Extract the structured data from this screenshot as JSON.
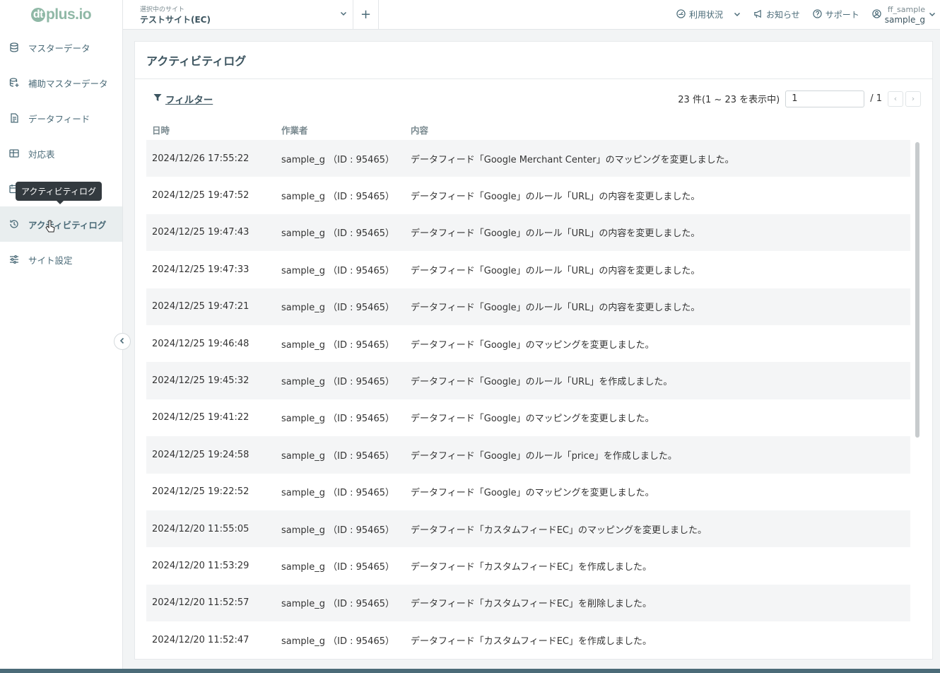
{
  "logo": {
    "mark": "dt",
    "text": "plus.io"
  },
  "sidebar": {
    "items": [
      {
        "label": "マスターデータ",
        "icon": "database-icon"
      },
      {
        "label": "補助マスターデータ",
        "icon": "database-plus-icon"
      },
      {
        "label": "データフィード",
        "icon": "document-icon"
      },
      {
        "label": "対応表",
        "icon": "table-icon"
      },
      {
        "label": "",
        "icon": "calendar-icon"
      },
      {
        "label": "アクティビティログ",
        "icon": "history-icon"
      },
      {
        "label": "サイト設定",
        "icon": "sliders-icon"
      }
    ],
    "tooltip": "アクティビティログ"
  },
  "header": {
    "site_caption": "選択中のサイト",
    "site_name": "テストサイト(EC)",
    "add": "+",
    "usage": "利用状況",
    "news": "お知らせ",
    "support": "サポート",
    "account": "ff_sample",
    "user": "sample_g"
  },
  "main": {
    "title": "アクティビティログ",
    "filter": "フィルター",
    "count": "23 件(1 ~ 23 を表示中)",
    "page_value": "1",
    "page_total": "/ 1",
    "columns": {
      "date": "日時",
      "user": "作業者",
      "content": "内容"
    },
    "rows": [
      {
        "date": "2024/12/26 17:55:22",
        "user": "sample_g （ID : 95465）",
        "content": "データフィード「Google Merchant Center」のマッピングを変更しました。"
      },
      {
        "date": "2024/12/25 19:47:52",
        "user": "sample_g （ID : 95465）",
        "content": "データフィード「Google」のルール「URL」の内容を変更しました。"
      },
      {
        "date": "2024/12/25 19:47:43",
        "user": "sample_g （ID : 95465）",
        "content": "データフィード「Google」のルール「URL」の内容を変更しました。"
      },
      {
        "date": "2024/12/25 19:47:33",
        "user": "sample_g （ID : 95465）",
        "content": "データフィード「Google」のルール「URL」の内容を変更しました。"
      },
      {
        "date": "2024/12/25 19:47:21",
        "user": "sample_g （ID : 95465）",
        "content": "データフィード「Google」のルール「URL」の内容を変更しました。"
      },
      {
        "date": "2024/12/25 19:46:48",
        "user": "sample_g （ID : 95465）",
        "content": "データフィード「Google」のマッピングを変更しました。"
      },
      {
        "date": "2024/12/25 19:45:32",
        "user": "sample_g （ID : 95465）",
        "content": "データフィード「Google」のルール「URL」を作成しました。"
      },
      {
        "date": "2024/12/25 19:41:22",
        "user": "sample_g （ID : 95465）",
        "content": "データフィード「Google」のマッピングを変更しました。"
      },
      {
        "date": "2024/12/25 19:24:58",
        "user": "sample_g （ID : 95465）",
        "content": "データフィード「Google」のルール「price」を作成しました。"
      },
      {
        "date": "2024/12/25 19:22:52",
        "user": "sample_g （ID : 95465）",
        "content": "データフィード「Google」のマッピングを変更しました。"
      },
      {
        "date": "2024/12/20 11:55:05",
        "user": "sample_g （ID : 95465）",
        "content": "データフィード「カスタムフィードEC」のマッピングを変更しました。"
      },
      {
        "date": "2024/12/20 11:53:29",
        "user": "sample_g （ID : 95465）",
        "content": "データフィード「カスタムフィードEC」を作成しました。"
      },
      {
        "date": "2024/12/20 11:52:57",
        "user": "sample_g （ID : 95465）",
        "content": "データフィード「カスタムフィードEC」を削除しました。"
      },
      {
        "date": "2024/12/20 11:52:47",
        "user": "sample_g （ID : 95465）",
        "content": "データフィード「カスタムフィードEC」を作成しました。"
      }
    ]
  },
  "colors": {
    "accent": "#4b6b78",
    "logo": "#8fb8a6",
    "active_bg": "#e9eeef"
  }
}
